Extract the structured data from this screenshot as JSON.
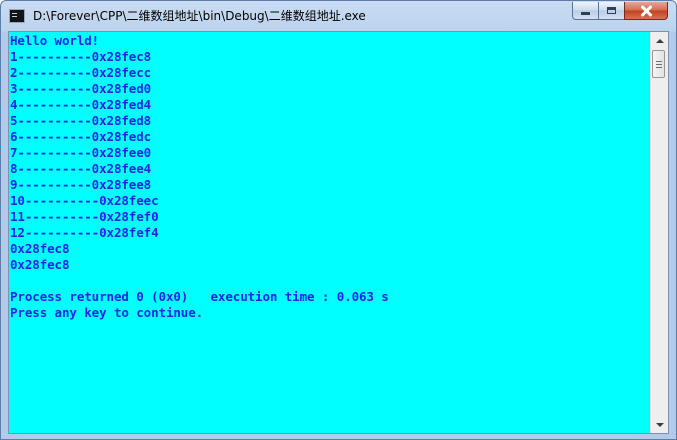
{
  "window": {
    "title": "D:\\Forever\\CPP\\二维数组地址\\bin\\Debug\\二维数组地址.exe"
  },
  "console": {
    "colors": {
      "background": "#00ffff",
      "text": "#2222ee"
    },
    "lines": [
      "Hello world!",
      "1----------0x28fec8",
      "2----------0x28fecc",
      "3----------0x28fed0",
      "4----------0x28fed4",
      "5----------0x28fed8",
      "6----------0x28fedc",
      "7----------0x28fee0",
      "8----------0x28fee4",
      "9----------0x28fee8",
      "10----------0x28feec",
      "11----------0x28fef0",
      "12----------0x28fef4",
      "0x28fec8",
      "0x28fec8",
      "",
      "Process returned 0 (0x0)   execution time : 0.063 s",
      "Press any key to continue."
    ]
  },
  "icons": {
    "app": "console-app-icon",
    "minimize": "minimize-icon",
    "maximize": "maximize-icon",
    "close": "close-icon",
    "scroll_up": "scroll-up-arrow-icon",
    "scroll_down": "scroll-down-arrow-icon"
  }
}
